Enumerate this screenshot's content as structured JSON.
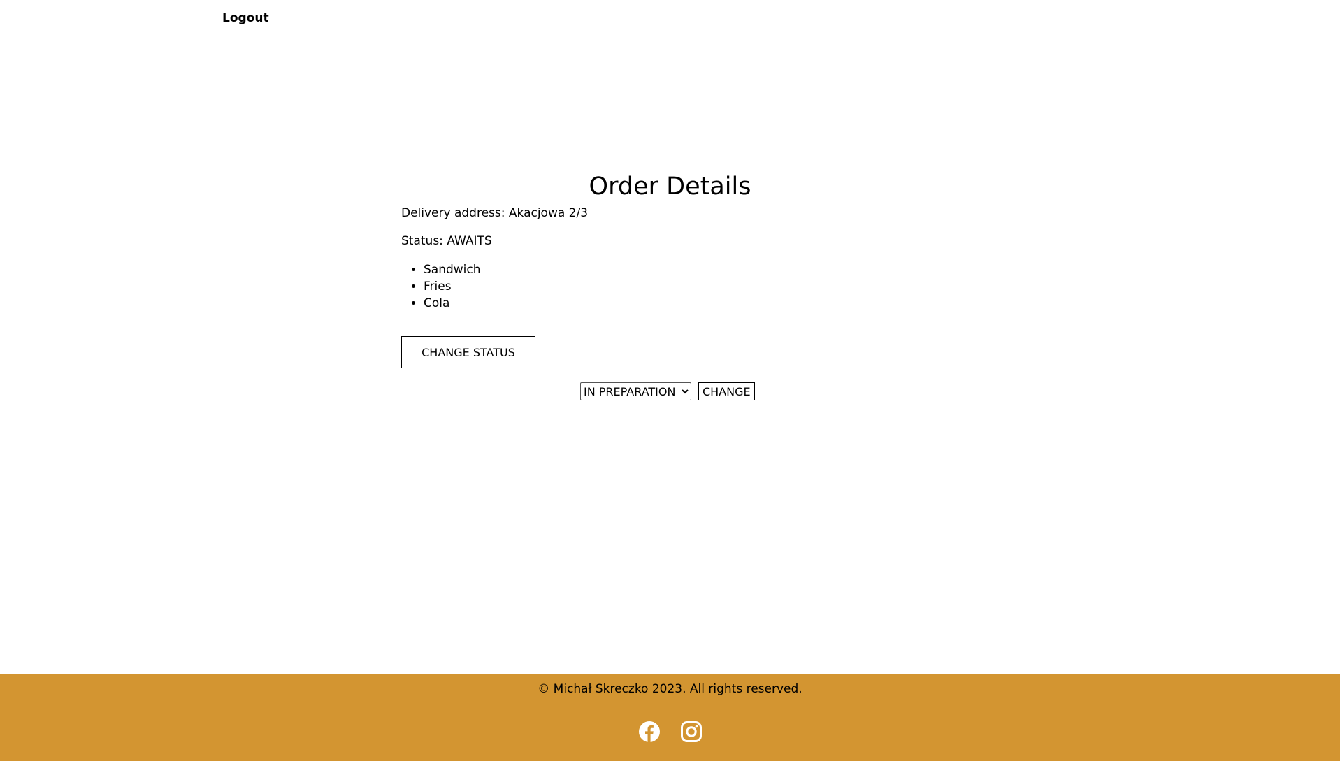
{
  "nav": {
    "logout_label": "Logout"
  },
  "order": {
    "title": "Order Details",
    "delivery_address_label": "Delivery address:",
    "delivery_address_value": "Akacjowa 2/3",
    "status_label": "Status:",
    "status_value": "AWAITS",
    "items": [
      "Sandwich",
      "Fries",
      "Cola"
    ]
  },
  "actions": {
    "change_status_label": "CHANGE STATUS",
    "status_select_value": "IN PREPARATION",
    "change_label": "CHANGE"
  },
  "footer": {
    "copyright": "© Michał Skreczko 2023. All rights reserved.",
    "social": [
      "facebook-icon",
      "instagram-icon"
    ],
    "background_color": "#d39531"
  }
}
